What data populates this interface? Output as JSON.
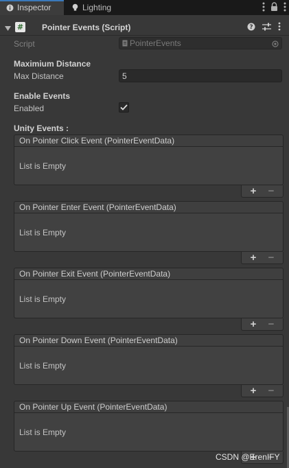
{
  "tabs": {
    "inspector": "Inspector",
    "lighting": "Lighting"
  },
  "component": {
    "title": "Pointer Events (Script)"
  },
  "fields": {
    "script_label": "Script",
    "script_value": "PointerEvents",
    "section_max": "Maximium Distance",
    "max_distance_label": "Max Distance",
    "max_distance_value": "5",
    "section_enable": "Enable Events",
    "enabled_label": "Enabled",
    "enabled_checked": true,
    "section_unity": "Unity Events :"
  },
  "events": [
    {
      "title": "On Pointer Click Event (PointerEventData)",
      "body": "List is Empty"
    },
    {
      "title": "On Pointer Enter Event (PointerEventData)",
      "body": "List is Empty"
    },
    {
      "title": "On Pointer Exit Event (PointerEventData)",
      "body": "List is Empty"
    },
    {
      "title": "On Pointer Down Event (PointerEventData)",
      "body": "List is Empty"
    },
    {
      "title": "On Pointer Up Event (PointerEventData)",
      "body": "List is Empty"
    }
  ],
  "add_symbol": "+",
  "remove_symbol": "−",
  "watermark": "CSDN @ErenIFY",
  "colors": {
    "background": "#383838",
    "tab_accent": "#3a79bb",
    "script_icon_bg": "#e6e6e6"
  },
  "icons": [
    "info-icon",
    "lightbulb-icon",
    "more-vertical-icon",
    "lock-icon",
    "foldout-arrow-icon",
    "csharp-script-icon",
    "help-icon",
    "presets-icon",
    "script-asset-icon",
    "object-picker-icon",
    "checkmark-icon"
  ]
}
